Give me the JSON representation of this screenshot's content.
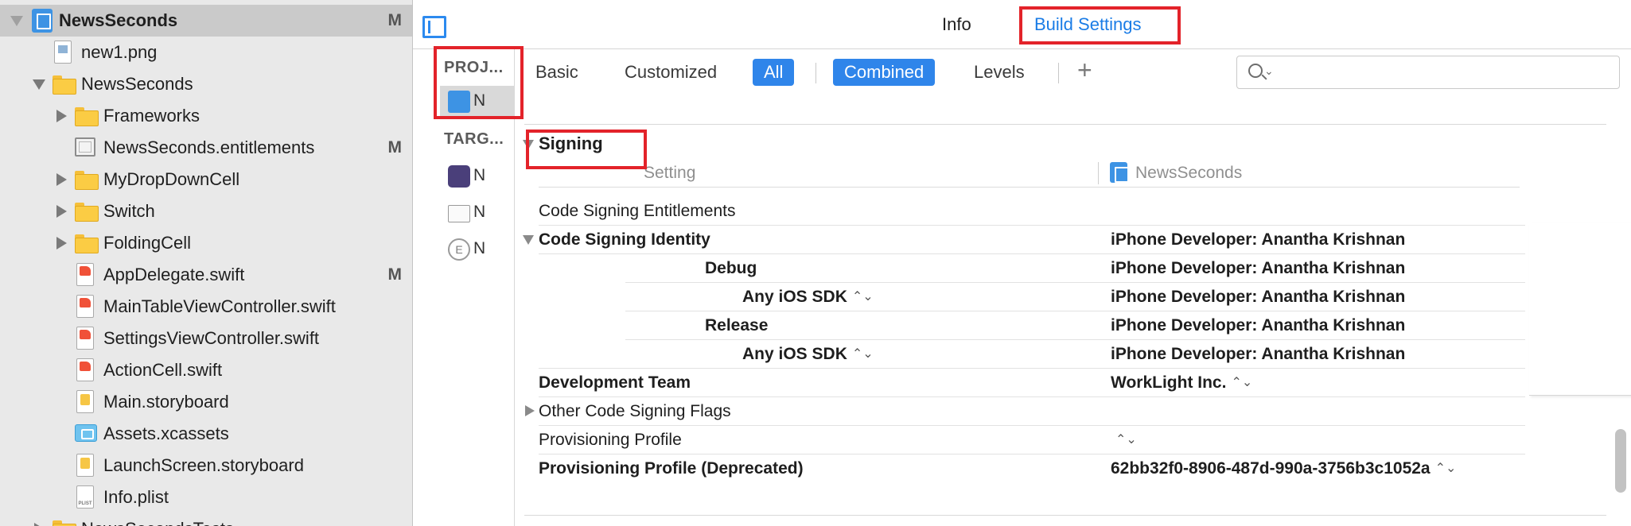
{
  "navigator": {
    "items": [
      {
        "label": "NewsSeconds",
        "badge": "M"
      },
      {
        "label": "new1.png",
        "badge": ""
      },
      {
        "label": "NewsSeconds",
        "badge": ""
      },
      {
        "label": "Frameworks",
        "badge": ""
      },
      {
        "label": "NewsSeconds.entitlements",
        "badge": "M"
      },
      {
        "label": "MyDropDownCell",
        "badge": ""
      },
      {
        "label": "Switch",
        "badge": ""
      },
      {
        "label": "FoldingCell",
        "badge": ""
      },
      {
        "label": "AppDelegate.swift",
        "badge": "M"
      },
      {
        "label": "MainTableViewController.swift",
        "badge": ""
      },
      {
        "label": "SettingsViewController.swift",
        "badge": ""
      },
      {
        "label": "ActionCell.swift",
        "badge": ""
      },
      {
        "label": "Main.storyboard",
        "badge": ""
      },
      {
        "label": "Assets.xcassets",
        "badge": ""
      },
      {
        "label": "LaunchScreen.storyboard",
        "badge": ""
      },
      {
        "label": "Info.plist",
        "badge": ""
      },
      {
        "label": "NewsSecondsTests",
        "badge": ""
      }
    ]
  },
  "editor": {
    "tabs": {
      "info": "Info",
      "build_settings": "Build Settings"
    },
    "project_header": "PROJ...",
    "targets_header": "TARG...",
    "truncated_item": "N",
    "filters": {
      "basic": "Basic",
      "customized": "Customized",
      "all": "All",
      "combined": "Combined",
      "levels": "Levels",
      "add": "+"
    },
    "search": {
      "placeholder": "",
      "chevron": "⌄"
    }
  },
  "settings": {
    "section_title": "Signing",
    "column_setting": "Setting",
    "column_target": "NewsSeconds",
    "rows": [
      {
        "name": "Code Signing Entitlements",
        "value": ""
      },
      {
        "name": "Code Signing Identity",
        "value": "iPhone Developer: Anantha Krishnan"
      },
      {
        "name": "Debug",
        "value": "iPhone Developer: Anantha Krishnan"
      },
      {
        "name": "Any iOS SDK",
        "value": "iPhone Developer: Anantha Krishnan"
      },
      {
        "name": "Release",
        "value": "iPhone Developer: Anantha Krishnan"
      },
      {
        "name": "Any iOS SDK",
        "value": "iPhone Developer: Anantha Krishnan"
      },
      {
        "name": "Development Team",
        "value": "WorkLight Inc."
      },
      {
        "name": "Other Code Signing Flags",
        "value": ""
      },
      {
        "name": "Provisioning Profile",
        "value": ""
      },
      {
        "name": "Provisioning Profile (Deprecated)",
        "value": "62bb32f0-8906-487d-990a-3756b3c1052a"
      }
    ],
    "updown_glyph": "⌃⌄"
  },
  "colors": {
    "accent": "#2f85ea",
    "annotation_red": "#e3232a",
    "sidebar_bg": "#e9e9e9"
  }
}
